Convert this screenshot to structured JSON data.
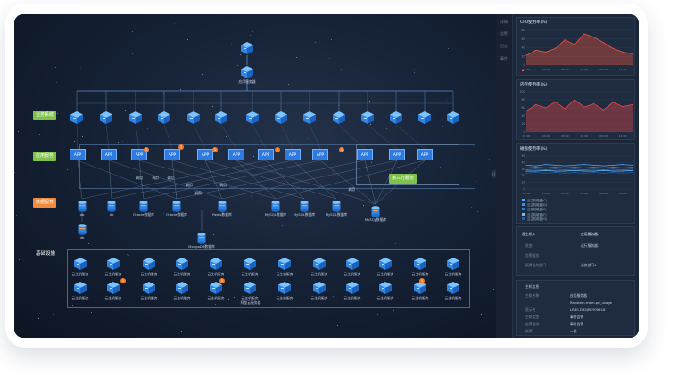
{
  "topology": {
    "top_node_label": "应用服务器",
    "row_labels": {
      "business": "业务系统",
      "application": "应用服务",
      "database": "数据服务",
      "infrastructure": "基础设施"
    },
    "app_label": "APP",
    "group_label": "第三方服务",
    "database_labels": [
      "db",
      "db",
      "Oracle数据库",
      "Oracle数据库",
      "Redis数据库",
      "MySQL数据库",
      "MySQL数据库",
      "MySQL数据库",
      "MySQL数据库",
      "MongoDB数据库",
      "db"
    ],
    "infra_label": "云主机服务",
    "infra_group_label": "阿里云服务器",
    "badges": [
      "1",
      "1",
      "1",
      "1",
      "1",
      "1",
      "1",
      "1",
      "1",
      "1"
    ],
    "link_labels": [
      "调用",
      "调用",
      "调用",
      "调用",
      "调用",
      "调用"
    ],
    "side_label": "调用"
  },
  "panel": {
    "rail_items": [
      "详情",
      "告警",
      "日志",
      "事件"
    ],
    "cpu": {
      "title": "CPU使用率(%)",
      "legend": "云主机CPU",
      "chart_data": {
        "type": "area",
        "x": [
          "01:00",
          "02:00",
          "03:00",
          "04:00",
          "05:00",
          "06:00",
          "07:00",
          "08:00",
          "09:00",
          "10:00",
          "11:00",
          "12:00"
        ],
        "series": [
          {
            "name": "云主机CPU",
            "values": [
              22,
              34,
              30,
              38,
              58,
              47,
              72,
              64,
              52,
              38,
              30,
              26
            ]
          }
        ],
        "ylim": [
          0,
          80
        ],
        "yticks": [
          "80",
          "60",
          "40",
          "20",
          "0"
        ],
        "color": "#ff5a3c"
      }
    },
    "mem": {
      "title": "内存使用率(%)",
      "chart_data": {
        "type": "area",
        "x": [
          "01:00",
          "02:00",
          "03:00",
          "04:00",
          "05:00",
          "06:00",
          "07:00",
          "08:00",
          "09:00",
          "10:00",
          "11:00",
          "12:00"
        ],
        "series": [
          {
            "name": "内存",
            "values": [
              52,
              68,
              60,
              75,
              58,
              80,
              62,
              70,
              55,
              74,
              63,
              68
            ]
          }
        ],
        "ylim": [
          0,
          100
        ],
        "yticks": [
          "100",
          "80",
          "60",
          "40",
          "20",
          "0"
        ],
        "color": "#ff4a4a"
      }
    },
    "disk": {
      "title": "磁盘使用率(%)",
      "legend": [
        "云主机磁盘(C)",
        "云主机磁盘(D)",
        "云主机磁盘(E)",
        "云主机磁盘(F)",
        "云主机磁盘(G)"
      ],
      "chart_data": {
        "type": "line",
        "x": [
          "01:00",
          "02:00",
          "03:00",
          "04:00",
          "05:00",
          "06:00",
          "07:00",
          "08:00",
          "09:00",
          "10:00",
          "11:00",
          "12:00"
        ],
        "series": [
          {
            "name": "云主机磁盘(C)",
            "values": [
              36,
              35,
              37,
              36,
              35,
              36,
              37,
              36,
              35,
              36,
              37,
              36
            ]
          },
          {
            "name": "云主机磁盘(D)",
            "values": [
              32,
              33,
              32,
              33,
              32,
              33,
              32,
              33,
              32,
              33,
              32,
              33
            ]
          },
          {
            "name": "云主机磁盘(E)",
            "values": [
              29,
              30,
              29,
              30,
              29,
              30,
              29,
              30,
              29,
              30,
              29,
              30
            ]
          },
          {
            "name": "云主机磁盘(F)",
            "values": [
              27,
              27,
              28,
              27,
              27,
              28,
              27,
              27,
              28,
              27,
              27,
              28
            ]
          },
          {
            "name": "云主机磁盘(G)",
            "values": [
              24,
              25,
              24,
              25,
              24,
              25,
              24,
              25,
              24,
              25,
              24,
              25
            ]
          }
        ],
        "ylim": [
          0,
          50
        ],
        "yticks": [
          "50",
          "40",
          "30",
          "20",
          "10",
          "0"
        ],
        "colors": [
          "#4aa8ff",
          "#3c8fe8",
          "#2f78cc",
          "#6cc3ff",
          "#1f5fae"
        ]
      }
    },
    "alarm": {
      "left_title": "云主机 1",
      "right_title": "应用服务器1",
      "rows": [
        {
          "key": "状态",
          "value": "运行服务器1"
        },
        {
          "key": "告警级别",
          "value": ""
        },
        {
          "key": "所属业务部门",
          "value": "业务部门A"
        }
      ]
    },
    "info": {
      "title": "主机信息",
      "rows": [
        {
          "key": "主机名称",
          "value": "应用服务器"
        },
        {
          "key": "",
          "value": "Raystem.mem.pd_usage"
        },
        {
          "key": "显示名",
          "value": "LRBS.DB5JRCY09918"
        },
        {
          "key": "主机类型",
          "value": "事件告警"
        },
        {
          "key": "告警级别",
          "value": "事件告警"
        },
        {
          "key": "所属",
          "value": "一般"
        }
      ]
    }
  }
}
